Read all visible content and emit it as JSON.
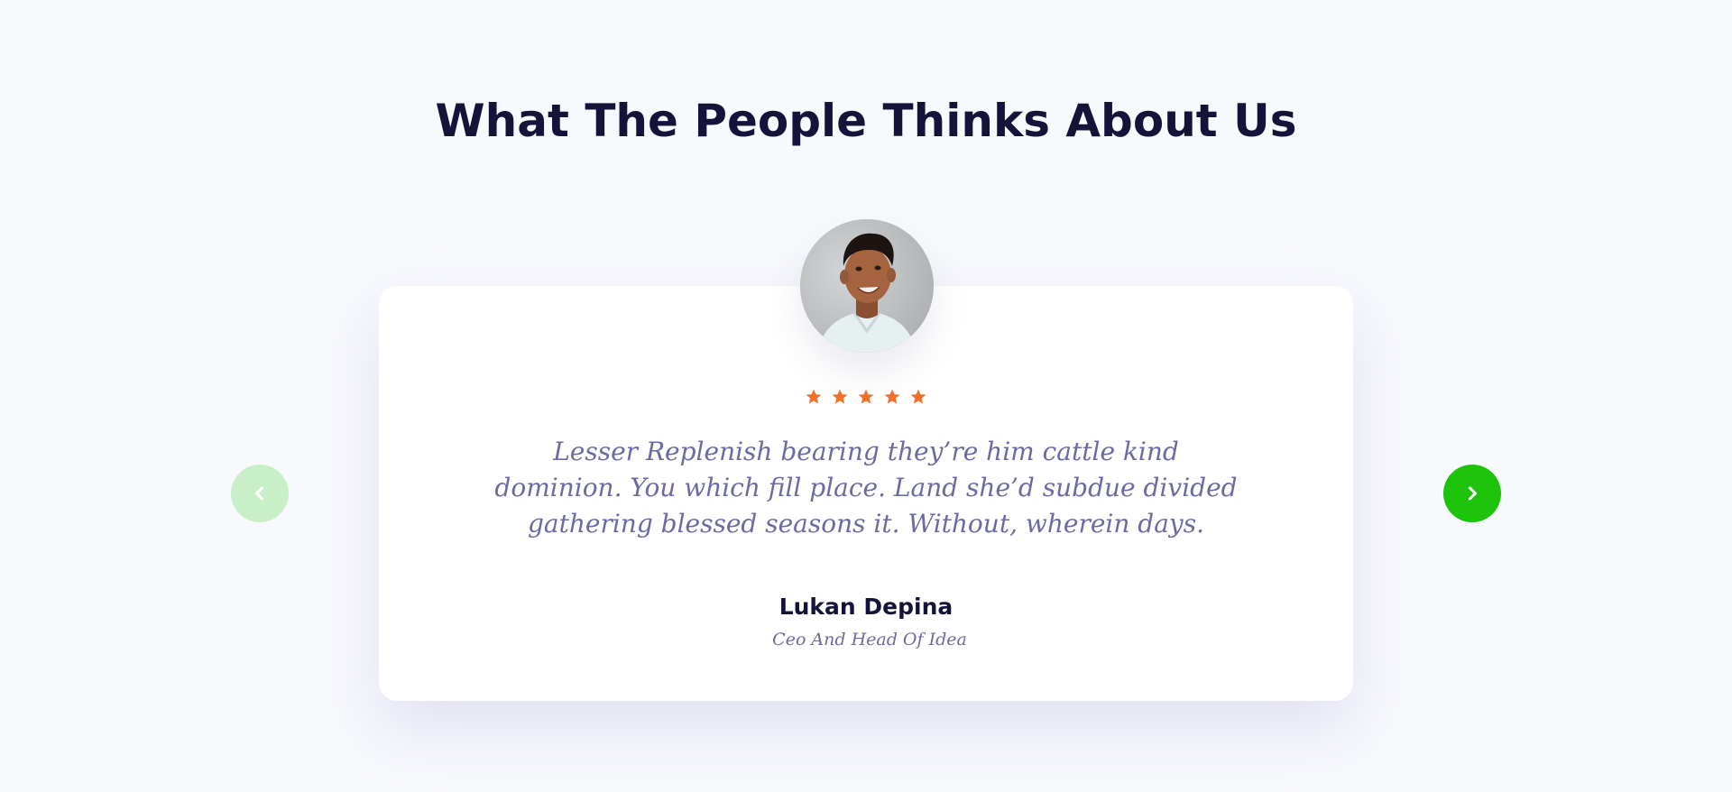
{
  "testimonials": {
    "heading": "What The People Thinks About Us",
    "rating": {
      "value": 5,
      "max": 5,
      "star_icon": "star-icon",
      "star_color": "#f36f2a"
    },
    "quote": "Lesser Replenish bearing they’re him cattle kind dominion. You which fill place. Land she’d subdue divided gathering blessed seasons it. Without, wherein days.",
    "author": {
      "name": "Lukan Depina",
      "role": "Ceo And Head Of Idea"
    },
    "nav": {
      "prev_icon": "chevron-left-icon",
      "next_icon": "chevron-right-icon",
      "prev_color": "#c9efc8",
      "next_color": "#1dc20a"
    },
    "colors": {
      "background": "#f8f9fd",
      "heading": "#16133a",
      "body_text": "#6d6aa3",
      "card": "#ffffff"
    }
  }
}
